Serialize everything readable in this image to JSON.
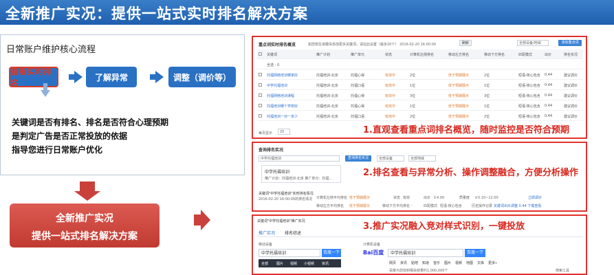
{
  "title": "全新推广实况：提供一站式实时排名解决方案",
  "left": {
    "flow_title": "日常账户维护核心流程",
    "steps": [
      "查看实时排名",
      "了解异常",
      "调整（调价等）"
    ],
    "desc": [
      "关键词是否有排名、排名是否符合心理预期",
      "是判定广告是否正常投放的依据",
      "指导您进行日常账户优化"
    ],
    "red_box": [
      "全新推广实况",
      "提供一站式排名解决方案"
    ]
  },
  "colors": {
    "title_bg": "#1f5fae",
    "step_bg": "#2a71c4",
    "accent_red": "#d7281f",
    "box_red": "#c03a31"
  },
  "panel1": {
    "callout": "1.直观查看重点词排名概览，随时监控是否符合预期",
    "header_title": "重点词实时排名概览",
    "header_note": "如您想在该模块添加更多关键词，请在此设置（最多20个）  2016-02-20 16:00:00",
    "refresh": "刷新",
    "device": "全部设备/地域",
    "add_btn": "添加重点词",
    "columns": [
      "关键词",
      "推广计划",
      "推广单元",
      "状态",
      "计算机左侧排名",
      "移动左方排名",
      "移动下方排名",
      "匹配模式",
      "出价",
      "排名实况"
    ],
    "select_all": "全选 - 0",
    "rows": [
      {
        "kw": "托福网络培训哪家好",
        "plan": "托福培训-北京",
        "unit": "托福心得",
        "status": "有效中",
        "pc": "2位",
        "m1": "低于预期展示",
        "m2": "2位",
        "match": "短语-核心包含",
        "bid": "0.44",
        "act": "建议调价"
      },
      {
        "kw": "中学托福培训",
        "plan": "托福培训-北京",
        "unit": "托福口语",
        "status": "有效中",
        "pc": "1位",
        "m1": "低于预期展示",
        "m2": "1位",
        "match": "短语-核心包含",
        "bid": "0.44",
        "act": "建议调价"
      },
      {
        "kw": "托福网络培训课程",
        "plan": "托福培训-北京",
        "unit": "托福心得",
        "status": "有效中",
        "pc": "3位",
        "m1": "低于预期展示",
        "m2": "3位",
        "match": "短语-核心包含",
        "bid": "0.44",
        "act": "建议调价"
      },
      {
        "kw": "托福培训哪个学校好",
        "plan": "托福培训-北京",
        "unit": "托福心得",
        "status": "有效中",
        "pc": "1位",
        "m1": "低于预期展示",
        "m2": "1位",
        "match": "短语-核心包含",
        "bid": "0.44",
        "act": "建议调价"
      },
      {
        "kw": "托福培训一对一多少",
        "plan": "托福培训-北京",
        "unit": "托福口语",
        "status": "有效中",
        "pc": "2位",
        "m1": "低于预期展示",
        "m2": "2位",
        "match": "短语-核心包含",
        "bid": "0.44",
        "act": "建议调价"
      }
    ],
    "page_size_label": "每页显示",
    "page_size": "20",
    "pager": "1 2 3 4 5"
  },
  "panel2": {
    "callout": "2.排名查看与异常分析、操作调整融合，方便分析操作",
    "header": "查询排名实况",
    "query": "中学托福培训",
    "query_btn": "查询排名实况",
    "device": "全部设备",
    "region": "全部地域",
    "suggest_title": "中学托福培训",
    "suggest_sub": "推广计划：托福培训-北京   推广单元：托福...",
    "line_a": "关键词\"中学托福培训\"实时排名情况",
    "line_a2": "2016-02-20 16:00:00的排名情况",
    "pc_label": "计算机左侧平均排名",
    "pc_val": "低于预期展示",
    "status_label": "状态",
    "status_val": "有效",
    "bid_label": "出价",
    "bid_val": "￥4.00",
    "qs_label": "质量度",
    "qs_val": "￥0.10~12.00",
    "mob_label": "移动左方平均排名",
    "mob_val": "低于预期展示",
    "mob2_label": "移动下方平均排名",
    "mob2_val": "-",
    "match_label": "匹配模式",
    "match_val": "短语-核心包含",
    "hist_label": "历史操作记录",
    "hist_val": "关键词出价调整 0.44 下载查看",
    "cta": "立即调价"
  },
  "panel3": {
    "callout": "3.推广实况融入竞对样式识别，一键投放",
    "header": "关键词\"中学托福培训\"推广实况",
    "tabs": [
      "推广实况",
      "排名综述"
    ],
    "preview_label": "移动设备",
    "search_value": "中学托福培训",
    "search_btn": "百度一下",
    "mobile_nav": [
      "全部",
      "图片",
      "视频",
      "小视频",
      "资讯"
    ],
    "pc_label": "计算机设备",
    "baidu_logo": "Bai百度",
    "pc_nav": [
      "网页",
      "资讯",
      "贴吧",
      "知道",
      "音乐",
      "图片",
      "视频",
      "地图",
      "文库",
      "更多»"
    ],
    "result_line": "百度为您找到相关结果约1,000,000个",
    "tool": "搜索工具"
  }
}
